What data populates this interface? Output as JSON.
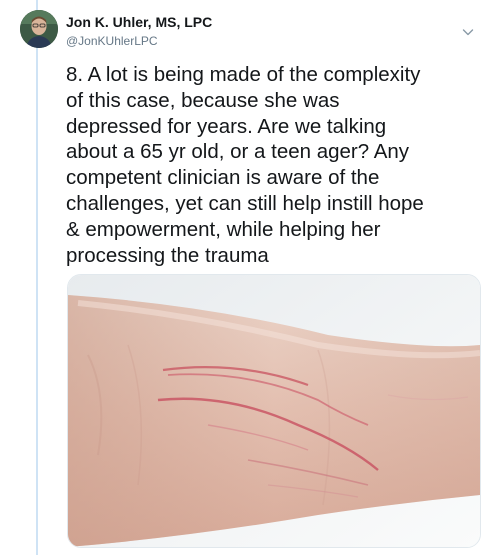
{
  "tweet": {
    "author": {
      "display_name": "Jon K. Uhler, MS, LPC",
      "handle": "@JonKUhlerLPC",
      "avatar_icon": "profile-photo"
    },
    "menu_icon": "chevron-down-icon",
    "text": "8. A lot is being made of the complexity\nof this case, because she was\ndepressed for years. Are we talking\nabout a 65 yr old, or a teen ager? Any\ncompetent clinician is aware of the\nchallenges, yet can still help instill hope\n& empowerment, while helping her\nprocessing the trauma",
    "media": {
      "type": "photo",
      "subject": "forearm-with-scars"
    }
  },
  "colors": {
    "thread_line": "#cfe3f5",
    "secondary_text": "#657786",
    "primary_text": "#14171a"
  }
}
